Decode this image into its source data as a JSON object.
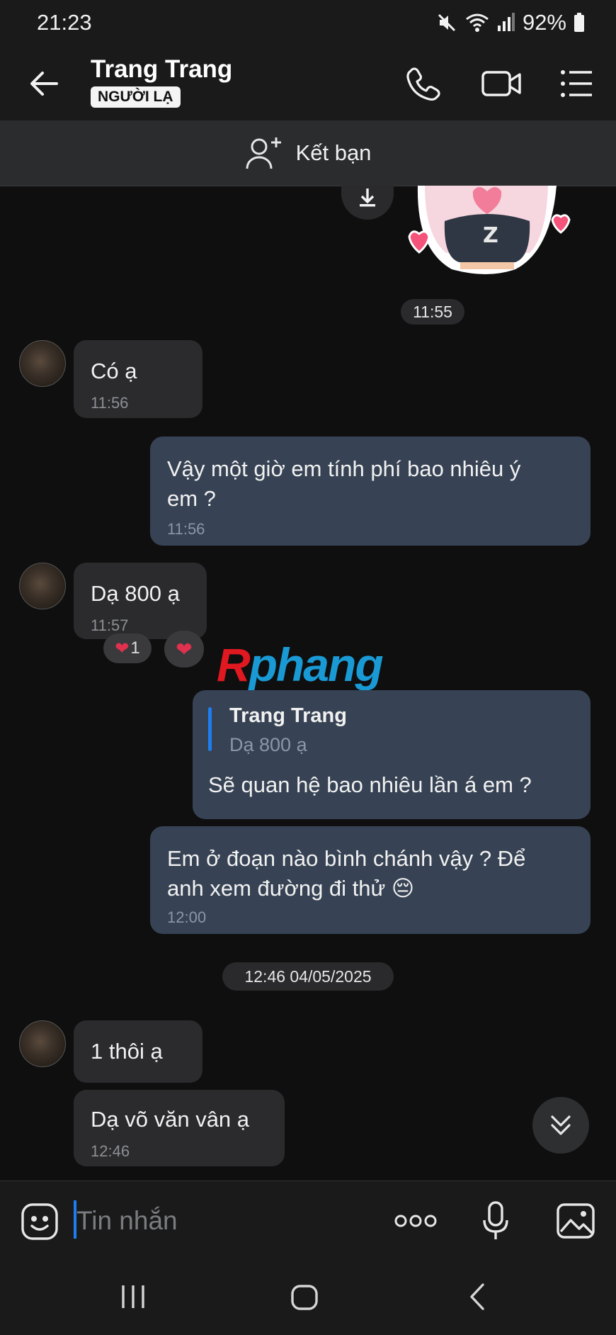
{
  "status_bar": {
    "time": "21:23",
    "battery": "92%"
  },
  "header": {
    "name": "Trang Trang",
    "badge": "NGƯỜI LẠ",
    "icons": [
      "back-arrow-icon",
      "phone-icon",
      "video-call-icon",
      "menu-list-icon"
    ]
  },
  "add_friend": {
    "label": "Kết bạn"
  },
  "chat": {
    "time_chip_1": "11:55",
    "m1": {
      "text": "Có ạ",
      "time": "11:56"
    },
    "m2": {
      "text_line1": "Vậy một giờ em tính phí bao nhiêu ý",
      "text_line2": "em ?",
      "time": "11:56"
    },
    "m3": {
      "text": "Dạ 800 ạ",
      "time": "11:57",
      "reaction_count": "1"
    },
    "watermark": "Rphang",
    "m4": {
      "reply_name": "Trang Trang",
      "reply_text": "Dạ 800 ạ",
      "text": "Sẽ quan hệ bao nhiêu lần á em ?"
    },
    "m5": {
      "text_line1": "Em ở đoạn nào bình chánh vậy ? Để",
      "text_line2": "anh xem đường đi thử 😔",
      "time": "12:00"
    },
    "time_chip_2": "12:46 04/05/2025",
    "m6": {
      "text": "1 thôi ạ"
    },
    "m7": {
      "text": "Dạ võ văn vân ạ",
      "time": "12:46"
    }
  },
  "input": {
    "placeholder": "Tin nhắn"
  },
  "colors": {
    "incoming_bubble": "#2b2b2d",
    "outgoing_bubble": "#374354",
    "reply_accent": "#1e7df0",
    "heart": "#e0314f"
  }
}
